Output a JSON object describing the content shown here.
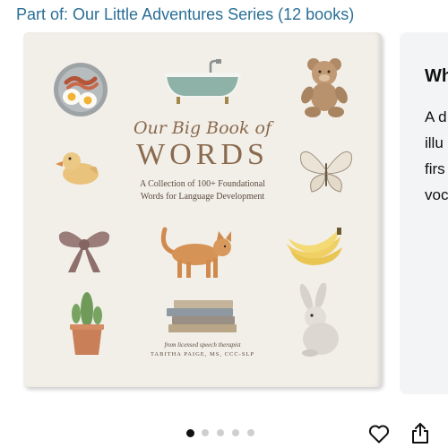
{
  "series": {
    "link_text": "Part of: Our Little Adventures Series (12 books)"
  },
  "book_cover": {
    "title_line1": "Our Big Book of",
    "title_main": "WORDS",
    "subtitle_line1": "A Collection of 100+ Foundational",
    "subtitle_line2": "Words for Language Development",
    "byline": "from licensed speech therapist",
    "author": "TABITHA PAIGE, MS, CCC-SLP"
  },
  "side_panel": {
    "heading": "Wh",
    "text_lines": [
      "A d",
      "illu",
      "firs",
      "voc"
    ]
  },
  "carousel": {
    "total_dots": 5,
    "active_index": 0
  },
  "actions": {
    "favorite_icon": "heart-icon",
    "share_icon": "share-icon"
  },
  "colors": {
    "link": "#2a6f97",
    "cover_bg": "#f2efe9",
    "title": "#8a6a4e"
  }
}
